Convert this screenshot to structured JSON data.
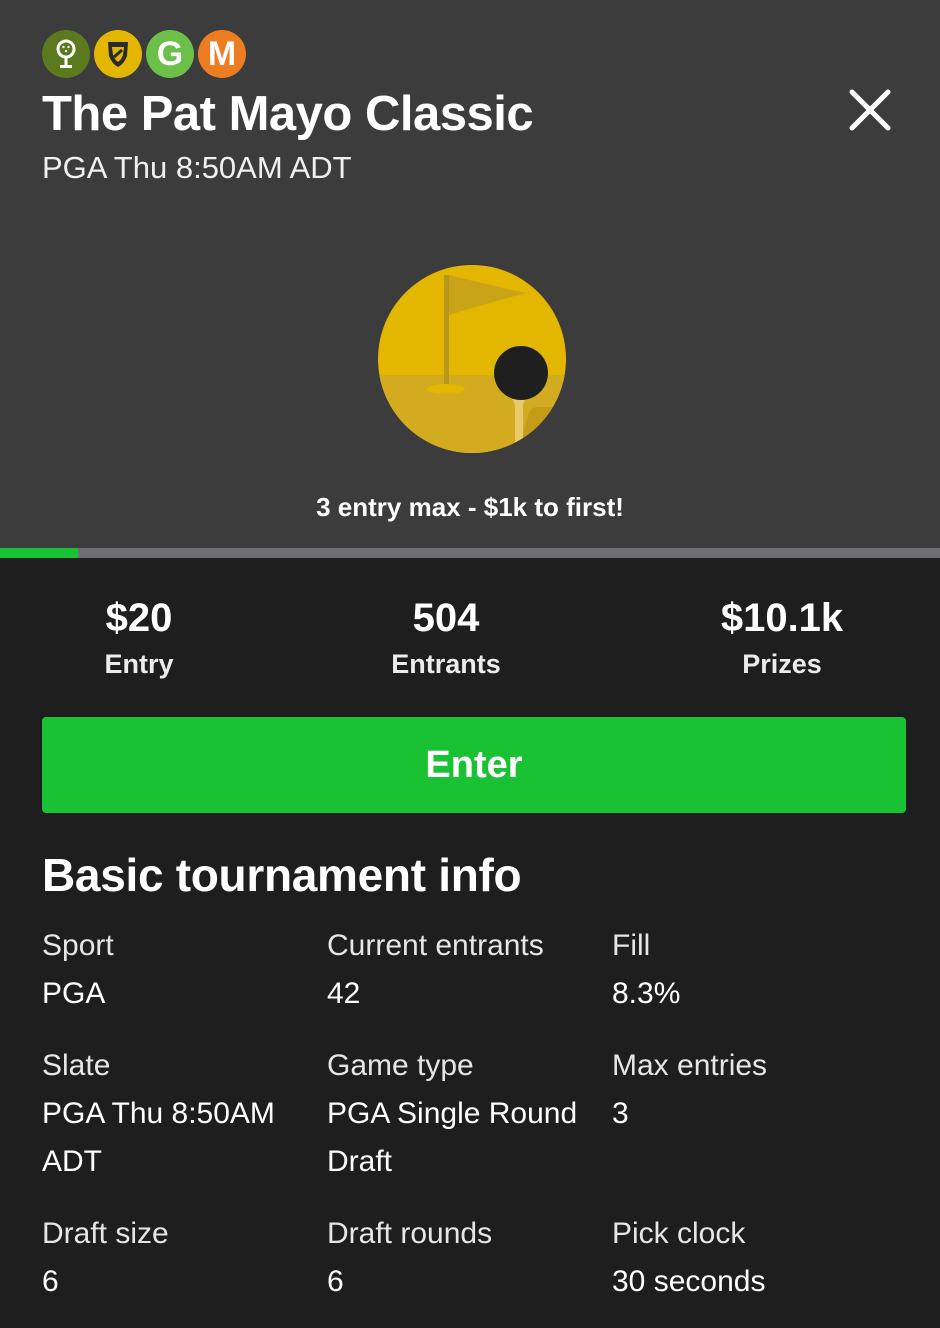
{
  "header": {
    "badges": [
      {
        "icon": "golf-ball-tee-icon",
        "color": "#5b7a1e"
      },
      {
        "icon": "shield-icon",
        "color": "#e3b600"
      },
      {
        "letter": "G",
        "color": "#6cc04a"
      },
      {
        "letter": "M",
        "color": "#ec7e21"
      }
    ],
    "title": "The Pat Mayo Classic",
    "subtitle": "PGA Thu 8:50AM ADT",
    "close_icon": "close-icon",
    "art_icon": "golf-flag-ball-icon",
    "tagline": "3 entry max - $1k to first!"
  },
  "progress": {
    "fill_fraction": 0.083,
    "fill_color": "#18c232",
    "track_color": "#6f6f71"
  },
  "stats": {
    "entry": {
      "value": "$20",
      "label": "Entry"
    },
    "entrants": {
      "value": "504",
      "label": "Entrants"
    },
    "prizes": {
      "value": "$10.1k",
      "label": "Prizes"
    }
  },
  "enter_button": {
    "label": "Enter",
    "color": "#18c232"
  },
  "info": {
    "title": "Basic tournament info",
    "sport": {
      "label": "Sport",
      "value": "PGA"
    },
    "current_entrants": {
      "label": "Current entrants",
      "value": "42"
    },
    "fill": {
      "label": "Fill",
      "value": "8.3%"
    },
    "slate": {
      "label": "Slate",
      "value": "PGA Thu 8:50AM ADT"
    },
    "game_type": {
      "label": "Game type",
      "value": "PGA Single Round Draft"
    },
    "max_entries": {
      "label": "Max entries",
      "value": "3"
    },
    "draft_size": {
      "label": "Draft size",
      "value": "6"
    },
    "draft_rounds": {
      "label": "Draft rounds",
      "value": "6"
    },
    "pick_clock": {
      "label": "Pick clock",
      "value": "30 seconds"
    }
  }
}
